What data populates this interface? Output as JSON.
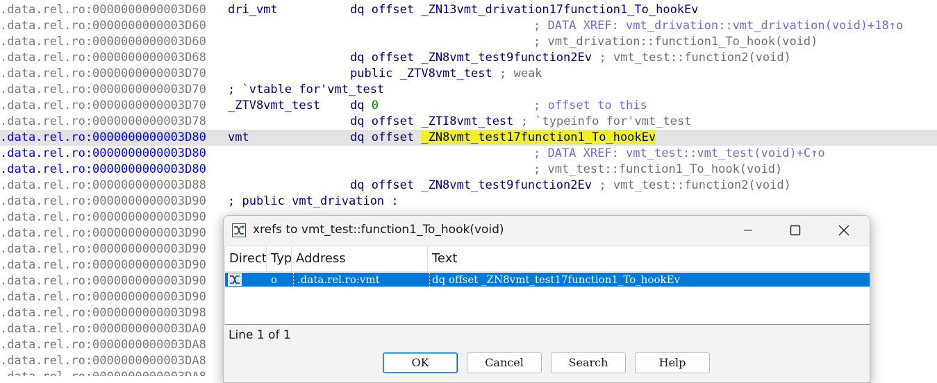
{
  "disasm": {
    "rows": [
      {
        "seg": ".data.rel.ro:0000000000003D60",
        "lbl": "dri_vmt",
        "ins": "dq offset _ZN13vmt_drivation17function1_To_hookEv",
        "cmt": ""
      },
      {
        "seg": ".data.rel.ro:0000000000003D60",
        "lbl": "",
        "ins": "",
        "cmt": "; DATA XREF: vmt_drivation::vmt_drivation(void)+18↑o"
      },
      {
        "seg": ".data.rel.ro:0000000000003D60",
        "lbl": "",
        "ins": "",
        "cmt": "; vmt_drivation::function1_To_hook(void)"
      },
      {
        "seg": ".data.rel.ro:0000000000003D68",
        "lbl": "",
        "ins": "dq offset _ZN8vmt_test9function2Ev",
        "cmt": "; vmt_test::function2(void)"
      },
      {
        "seg": ".data.rel.ro:0000000000003D70",
        "lbl": "",
        "ins": "public _ZTV8vmt_test",
        "cmt": "; weak"
      },
      {
        "seg": ".data.rel.ro:0000000000003D70",
        "lbl": "; `vtable for'vmt_test",
        "ins": "",
        "cmt": ""
      },
      {
        "seg": ".data.rel.ro:0000000000003D70",
        "lbl": "_ZTV8vmt_test",
        "ins_op": "dq",
        "ins_num": "0",
        "cmt": "; offset to this"
      },
      {
        "seg": ".data.rel.ro:0000000000003D78",
        "lbl": "",
        "ins": "dq offset _ZTI8vmt_test",
        "cmt": "; `typeinfo for'vmt_test"
      },
      {
        "seg": ".data.rel.ro:0000000000003D80",
        "lbl": "vmt",
        "ins_op": "dq offset",
        "ins_hl": "_ZN8vmt_test17function1_To_hookEv",
        "cmt": ""
      },
      {
        "seg": ".data.rel.ro:0000000000003D80",
        "lbl": "",
        "ins": "",
        "cmt": "; DATA XREF: vmt_test::vmt_test(void)+C↑o"
      },
      {
        "seg": ".data.rel.ro:0000000000003D80",
        "lbl": "",
        "ins": "",
        "cmt": "; vmt_test::function1_To_hook(void)"
      },
      {
        "seg": ".data.rel.ro:0000000000003D88",
        "lbl": "",
        "ins": "dq offset _ZN8vmt_test9function2Ev",
        "cmt": "; vmt_test::function2(void)"
      },
      {
        "seg": ".data.rel.ro:0000000000003D90",
        "lbl": "; public vmt_drivation :",
        "ins": "",
        "cmt": ""
      },
      {
        "seg": ".data.rel.ro:0000000000003D90",
        "lbl": "",
        "ins": "",
        "cmt": ""
      },
      {
        "seg": ".data.rel.ro:0000000000003D90",
        "lbl": "",
        "ins": "",
        "cmt": ""
      },
      {
        "seg": ".data.rel.ro:0000000000003D90",
        "lbl": "",
        "ins": "",
        "cmt": ""
      },
      {
        "seg": ".data.rel.ro:0000000000003D90",
        "lbl": "",
        "ins": "",
        "cmt": ""
      },
      {
        "seg": ".data.rel.ro:0000000000003D90",
        "lbl": "",
        "ins": "",
        "cmt": ""
      },
      {
        "seg": ".data.rel.ro:0000000000003D90",
        "lbl": "",
        "ins": "",
        "cmt": ""
      },
      {
        "seg": ".data.rel.ro:0000000000003D98",
        "lbl": "",
        "ins": "",
        "cmt": ""
      },
      {
        "seg": ".data.rel.ro:0000000000003DA0",
        "lbl": "",
        "ins": "",
        "cmt": ""
      },
      {
        "seg": ".data.rel.ro:0000000000003DA8",
        "lbl": "",
        "ins": "",
        "cmt": ""
      },
      {
        "seg": ".data.rel.ro:0000000000003DA8",
        "lbl": "",
        "ins": "",
        "cmt": ""
      },
      {
        "seg": ".data.rel.ro:0000000000003DA8",
        "lbl": "",
        "ins": "",
        "cmt": ""
      }
    ],
    "selected_row": 8,
    "blue_rows": [
      8,
      9,
      10
    ]
  },
  "dialog": {
    "title": "xrefs to vmt_test::function1_To_hook(void)",
    "columns": [
      "Direct",
      "Typ",
      "Address",
      "Text"
    ],
    "rows": [
      {
        "direction_icon": "xref-up-icon",
        "type": "o",
        "address": ".data.rel.ro:vmt",
        "text": "dq offset _ZN8vmt_test17function1_To_hookEv"
      }
    ],
    "status": "Line 1 of 1",
    "buttons": {
      "ok": "OK",
      "cancel": "Cancel",
      "search": "Search",
      "help": "Help"
    },
    "colors": {
      "selection": "#0078d7",
      "highlight": "#f0f028"
    }
  }
}
